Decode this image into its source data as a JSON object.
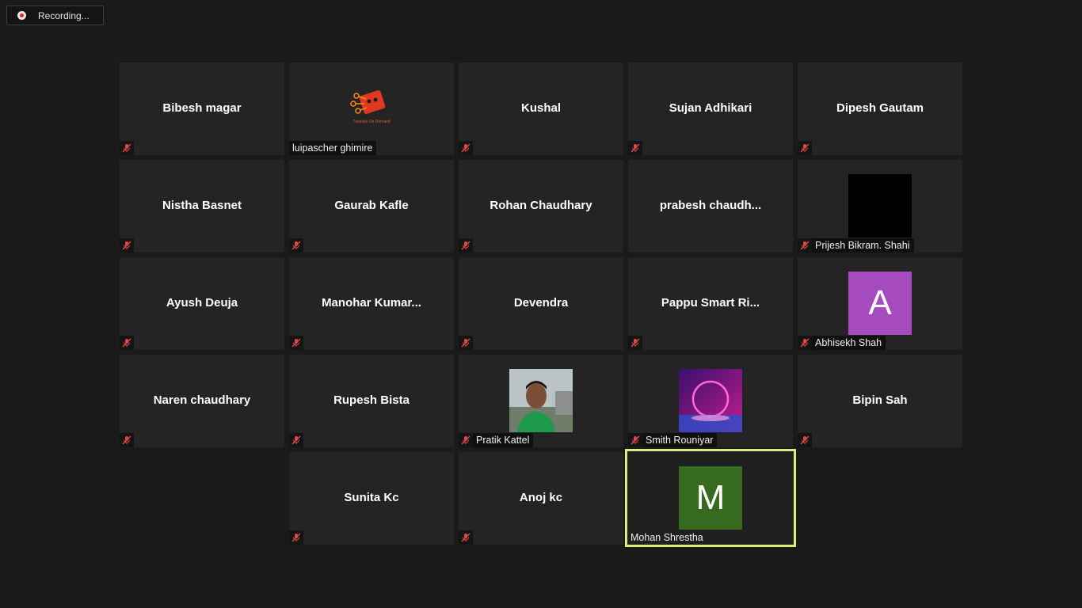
{
  "recording": {
    "label": "Recording..."
  },
  "participants": [
    {
      "name": "Bibesh magar"
    },
    {
      "name": "luipascher ghimire",
      "logo_text": "Tutorials On Demand"
    },
    {
      "name": "Kushal"
    },
    {
      "name": "Sujan Adhikari"
    },
    {
      "name": "Dipesh Gautam"
    },
    {
      "name": "Nistha Basnet"
    },
    {
      "name": "Gaurab Kafle"
    },
    {
      "name": "Rohan Chaudhary"
    },
    {
      "name": "prabesh  chaudh..."
    },
    {
      "name": "Prijesh Bikram. Shahi"
    },
    {
      "name": "Ayush Deuja"
    },
    {
      "name": "Manohar  Kumar..."
    },
    {
      "name": "Devendra"
    },
    {
      "name": "Pappu  Smart  Ri..."
    },
    {
      "name": "Abhisekh Shah",
      "avatar_letter": "A",
      "avatar_color": "#a64ac0"
    },
    {
      "name": "Naren chaudhary"
    },
    {
      "name": "Rupesh Bista"
    },
    {
      "name": "Pratik Kattel"
    },
    {
      "name": "Smith Rouniyar"
    },
    {
      "name": "Bipin Sah"
    },
    {
      "name": "Sunita Kc"
    },
    {
      "name": "Anoj kc"
    },
    {
      "name": "Mohan Shrestha",
      "avatar_letter": "M",
      "avatar_color": "#356a1f",
      "active_speaker": true
    }
  ],
  "colors": {
    "background": "#1a1a1a",
    "tile": "#242424",
    "active_border": "#dcea7c",
    "mute_icon": "#e04848"
  },
  "icons": {
    "recording": "record-dot-icon",
    "muted": "mic-muted-icon"
  }
}
